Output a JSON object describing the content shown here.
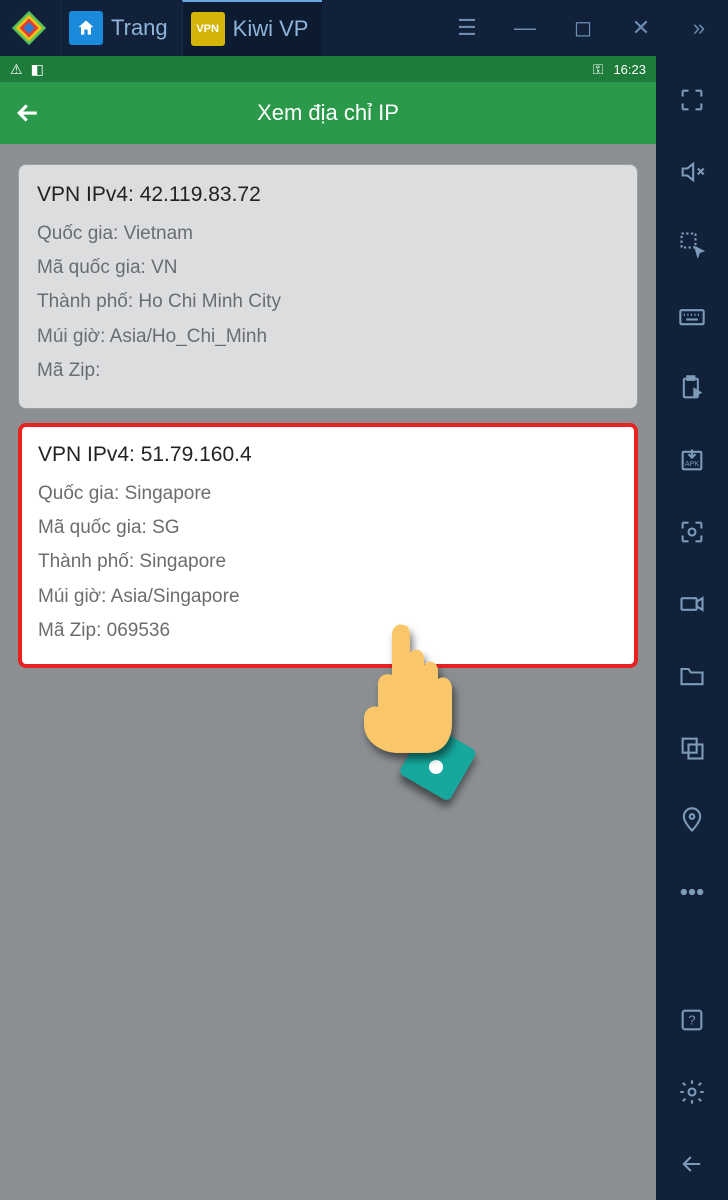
{
  "titlebar": {
    "tab1_label": "Trang",
    "tab2_label": "Kiwi VP"
  },
  "statusbar": {
    "time": "16:23"
  },
  "header": {
    "title": "Xem địa chỉ IP"
  },
  "labels": {
    "country": "Quốc gia:",
    "country_code": "Mã quốc gia:",
    "city": "Thành phố:",
    "timezone": "Múi giờ:",
    "zip": "Mã Zip:"
  },
  "card1": {
    "heading": "VPN IPv4: 42.119.83.72",
    "country": "Vietnam",
    "country_code": "VN",
    "city": "Ho Chi Minh City",
    "timezone": "Asia/Ho_Chi_Minh",
    "zip": ""
  },
  "card2": {
    "heading": "VPN IPv4: 51.79.160.4",
    "country": "Singapore",
    "country_code": "SG",
    "city": "Singapore",
    "timezone": "Asia/Singapore",
    "zip": "069536"
  }
}
